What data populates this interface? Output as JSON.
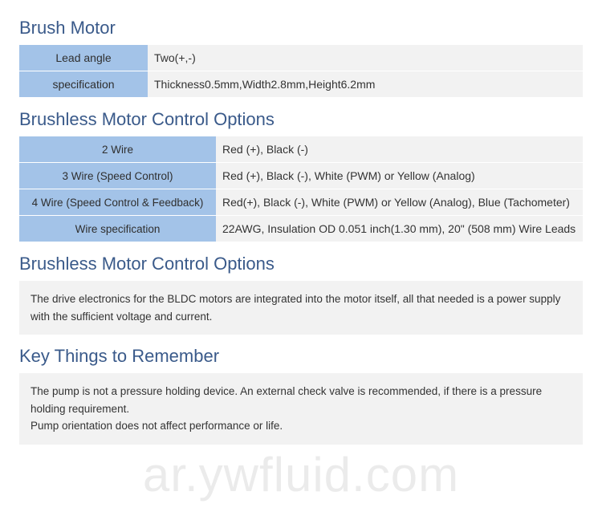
{
  "sections": {
    "brush_motor": {
      "title": "Brush Motor",
      "rows": [
        {
          "label": "Lead angle",
          "value": "Two(+,-)"
        },
        {
          "label": "specification",
          "value": "Thickness0.5mm,Width2.8mm,Height6.2mm"
        }
      ]
    },
    "brushless_options_table": {
      "title": "Brushless Motor Control Options",
      "rows": [
        {
          "label": "2 Wire",
          "value": "Red (+), Black (-)"
        },
        {
          "label": "3 Wire (Speed Control)",
          "value": "Red (+), Black (-), White (PWM) or Yellow (Analog)"
        },
        {
          "label": "4 Wire (Speed Control & Feedback)",
          "value": "Red(+), Black (-), White (PWM) or Yellow (Analog), Blue (Tachometer)"
        },
        {
          "label": "Wire specification",
          "value": "22AWG, Insulation OD 0.051 inch(1.30 mm), 20\" (508 mm) Wire Leads"
        }
      ]
    },
    "brushless_options_desc": {
      "title": "Brushless Motor Control Options",
      "text": "The drive electronics for the BLDC motors are integrated into the motor itself, all that needed is a power supply with the sufficient voltage and current."
    },
    "key_things": {
      "title": "Key Things to Remember",
      "line1": "The pump is not a pressure holding device. An external check valve is recommended, if there is a pressure holding requirement.",
      "line2": "Pump orientation does not affect performance or life."
    }
  },
  "watermark": "ar.ywfluid.com"
}
